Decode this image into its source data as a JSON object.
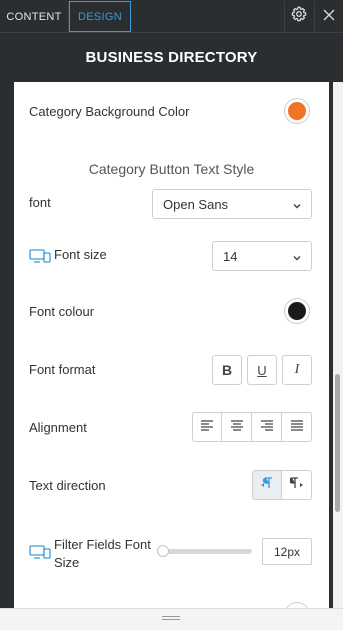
{
  "tabs": {
    "content": "CONTENT",
    "design": "DESIGN"
  },
  "toolbar": {
    "settings_icon": "gear-icon",
    "close_icon": "close-icon"
  },
  "header": {
    "title": "BUSINESS DIRECTORY"
  },
  "settings": {
    "category_bg_color": {
      "label": "Category Background Color",
      "value": "#f07427"
    },
    "section_title": "Category Button Text Style",
    "font": {
      "label": "font",
      "value": "Open Sans"
    },
    "font_size": {
      "label": "Font size",
      "value": "14",
      "device_icon": "desktop-mobile-icon"
    },
    "font_colour": {
      "label": "Font colour",
      "value": "#1a1a1a"
    },
    "font_format": {
      "label": "Font format",
      "buttons": [
        "B",
        "U",
        "I"
      ]
    },
    "alignment": {
      "label": "Alignment",
      "options": [
        "left",
        "center",
        "right",
        "justify"
      ]
    },
    "text_direction": {
      "label": "Text direction",
      "options": [
        "ltr",
        "rtl"
      ],
      "selected": "ltr"
    },
    "filter_fields_font_size": {
      "label": "Filter Fields Font Size",
      "value": "12px",
      "slider_fraction": 0.0
    }
  },
  "colors": {
    "accent": "#3a9ad9",
    "dark_bg": "#2b2e31",
    "panel_bg": "#ffffff"
  }
}
